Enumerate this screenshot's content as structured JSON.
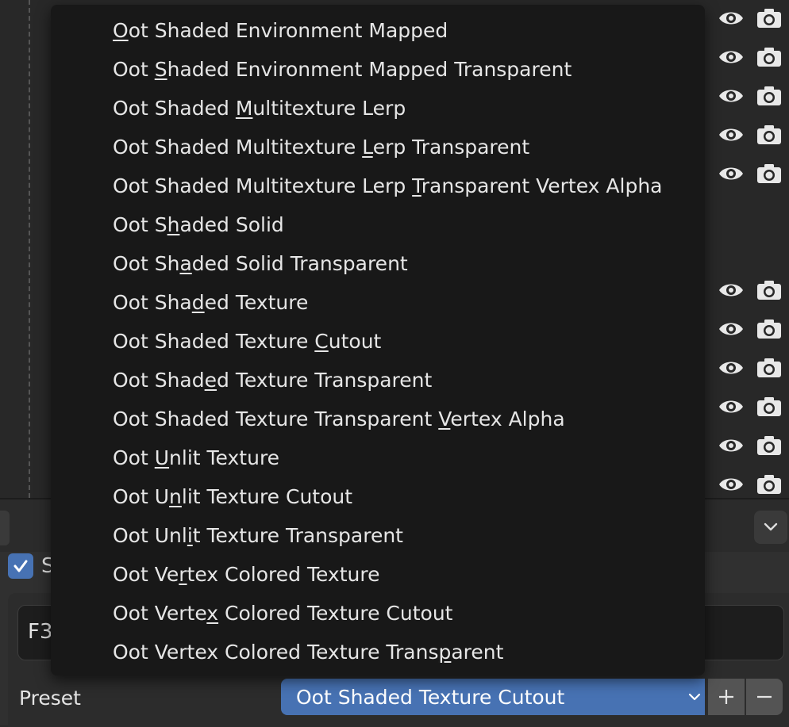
{
  "menu": {
    "items": [
      {
        "before": "",
        "key": "O",
        "after": "ot Shaded Environment Mapped"
      },
      {
        "before": "Oot ",
        "key": "S",
        "after": "haded Environment Mapped Transparent"
      },
      {
        "before": "Oot Shaded ",
        "key": "M",
        "after": "ultitexture Lerp"
      },
      {
        "before": "Oot Shaded Multitexture ",
        "key": "L",
        "after": "erp Transparent"
      },
      {
        "before": "Oot Shaded Multitexture Lerp ",
        "key": "T",
        "after": "ransparent Vertex Alpha"
      },
      {
        "before": "Oot S",
        "key": "h",
        "after": "aded Solid"
      },
      {
        "before": "Oot Sh",
        "key": "a",
        "after": "ded Solid Transparent"
      },
      {
        "before": "Oot Sha",
        "key": "d",
        "after": "ed Texture"
      },
      {
        "before": "Oot Shaded Texture ",
        "key": "C",
        "after": "utout"
      },
      {
        "before": "Oot Shad",
        "key": "e",
        "after": "d Texture Transparent"
      },
      {
        "before": "Oot Shaded Texture Transparent ",
        "key": "V",
        "after": "ertex Alpha"
      },
      {
        "before": "Oot ",
        "key": "U",
        "after": "nlit Texture"
      },
      {
        "before": "Oot U",
        "key": "n",
        "after": "lit Texture Cutout"
      },
      {
        "before": "Oot Unl",
        "key": "i",
        "after": "t Texture Transparent"
      },
      {
        "before": "Oot Ve",
        "key": "r",
        "after": "tex Colored Texture"
      },
      {
        "before": "Oot Verte",
        "key": "x",
        "after": " Colored Texture Cutout"
      },
      {
        "before": "Oot Vertex Colored Texture Trans",
        "key": "p",
        "after": "arent"
      }
    ]
  },
  "outliner": {
    "visibility_icons": [
      "eye-icon",
      "camera-icon"
    ]
  },
  "properties": {
    "checkbox_label": "S",
    "checkbox_checked": true,
    "field_text": "F3",
    "preset_label": "Preset",
    "preset_value": "Oot Shaded Texture Cutout",
    "add_label": "+",
    "remove_label": "−"
  },
  "colors": {
    "accent": "#4772b3",
    "menu_bg": "#181818",
    "panel_bg": "#303030"
  }
}
